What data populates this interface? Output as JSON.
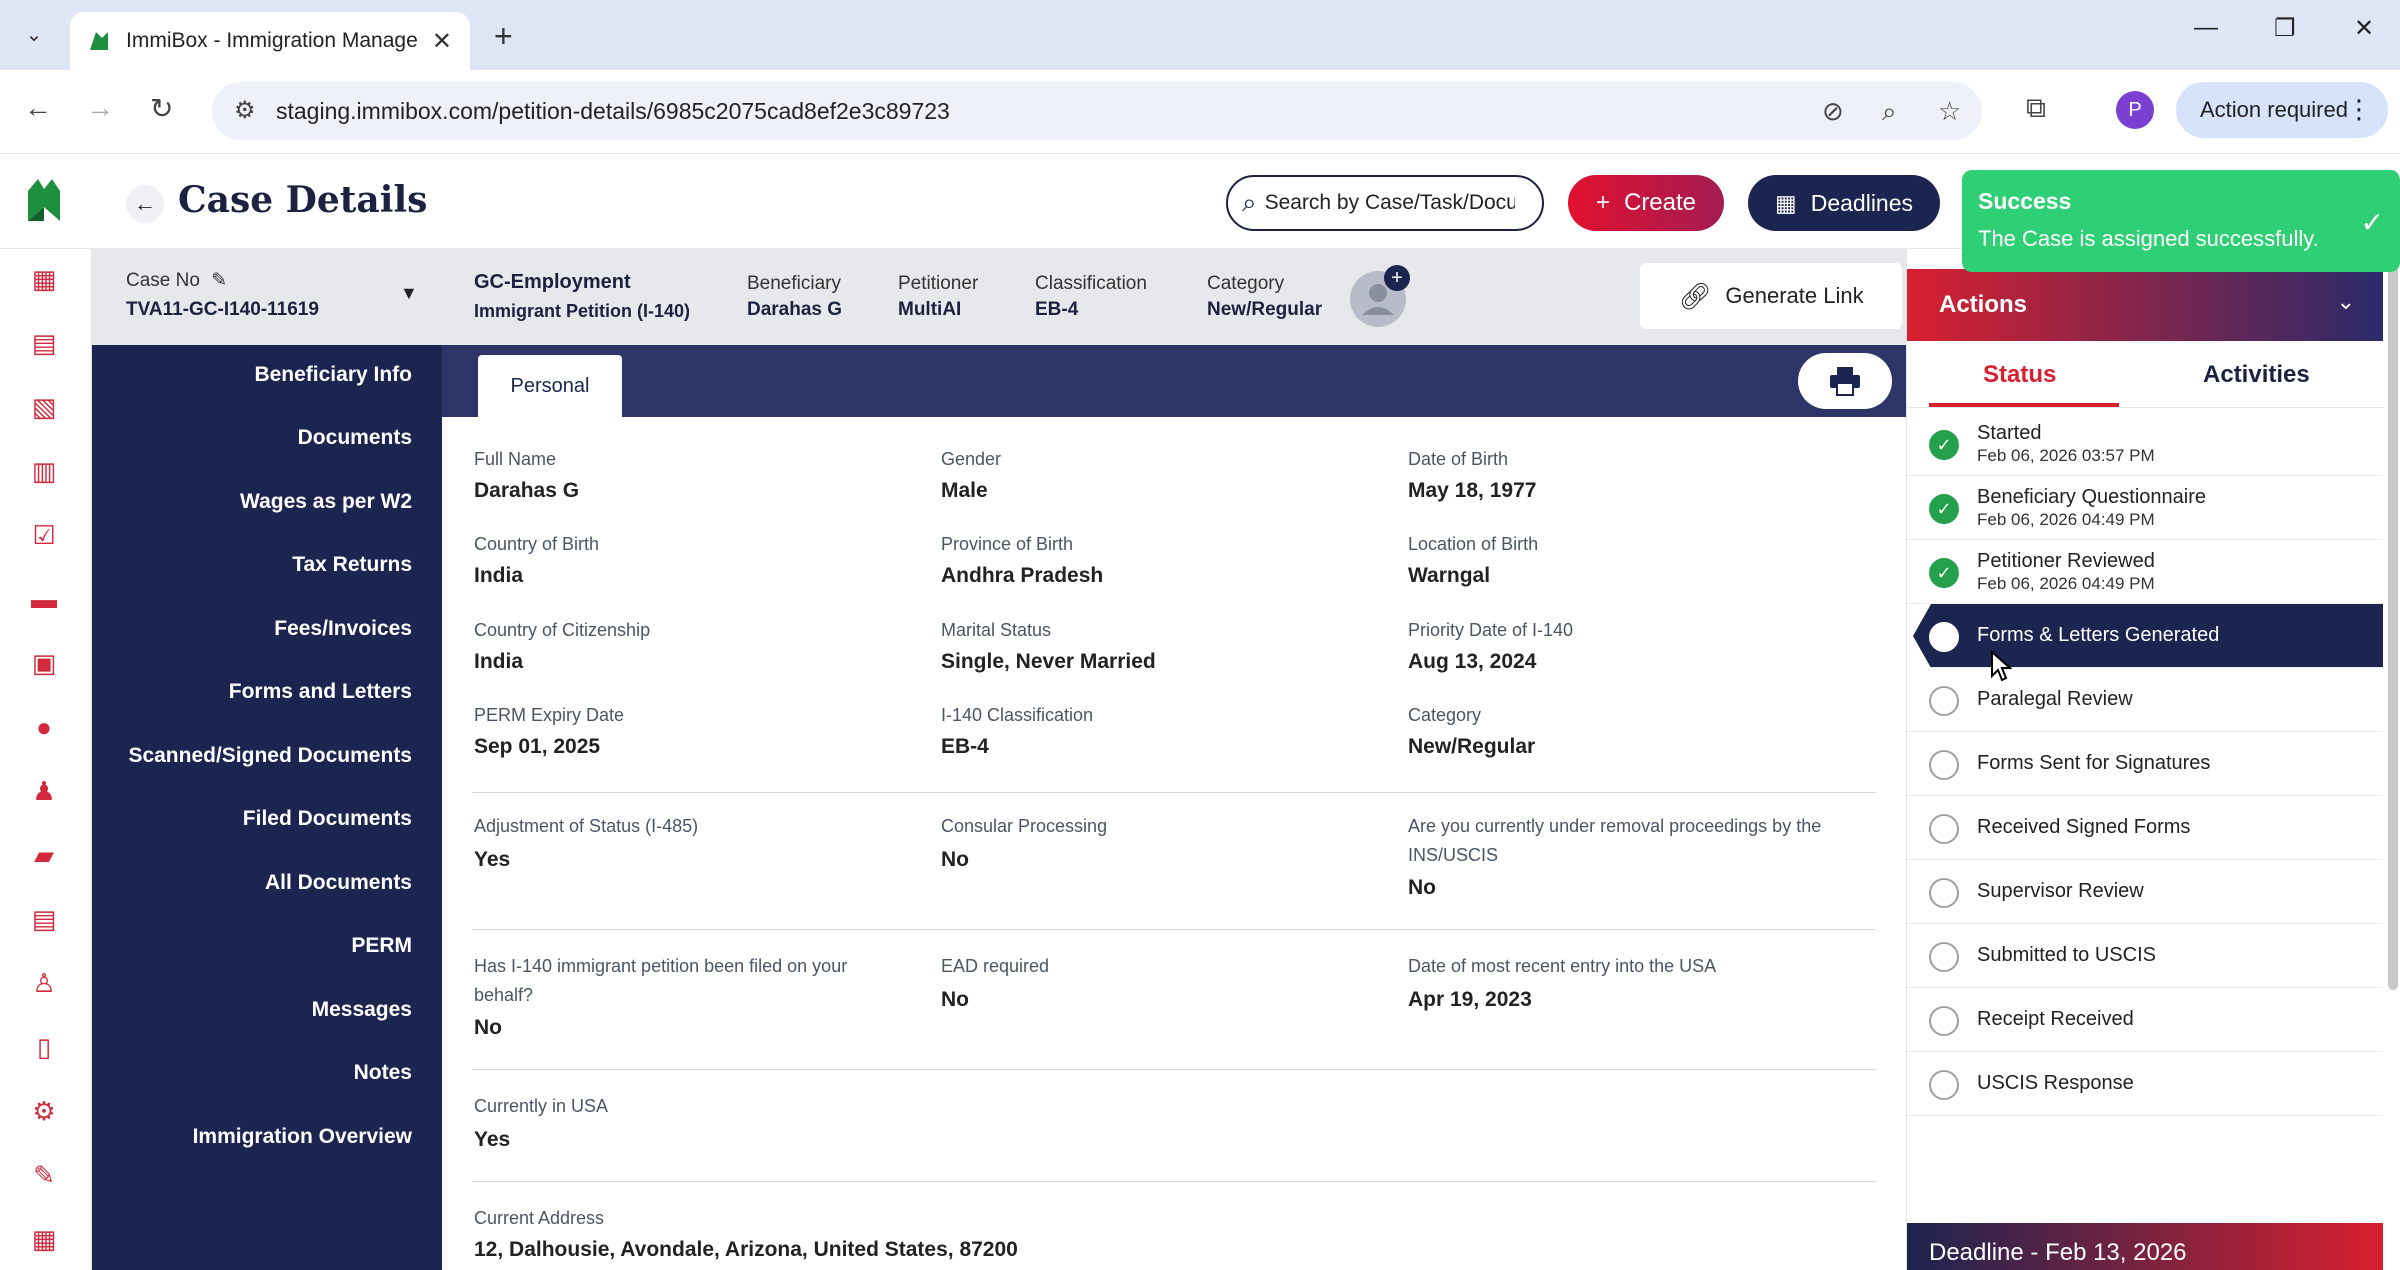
{
  "browser": {
    "tab_title": "ImmiBox - Immigration Manage",
    "url": "staging.immibox.com/petition-details/6985c2075cad8ef2e3c89723",
    "profile_initial": "P",
    "action_required": "Action required"
  },
  "header": {
    "title": "Case Details",
    "search_placeholder": "Search by Case/Task/Document",
    "create_label": "Create",
    "deadlines_label": "Deadlines"
  },
  "toast": {
    "title": "Success",
    "message": "The Case is assigned successfully."
  },
  "case_info": {
    "case_no_label": "Case No",
    "case_no": "TVA11-GC-I140-11619",
    "category_title": "GC-Employment",
    "petition_type": "Immigrant Petition (I-140)",
    "beneficiary_label": "Beneficiary",
    "beneficiary": "Darahas G",
    "petitioner_label": "Petitioner",
    "petitioner": "MultiAI",
    "classification_label": "Classification",
    "classification": "EB-4",
    "category_label": "Category",
    "category": "New/Regular",
    "generate_link": "Generate Link"
  },
  "section_nav": [
    "Beneficiary Info",
    "Documents",
    "Wages as per W2",
    "Tax Returns",
    "Fees/Invoices",
    "Forms and Letters",
    "Scanned/Signed Documents",
    "Filed Documents",
    "All Documents",
    "PERM",
    "Messages",
    "Notes",
    "Immigration Overview"
  ],
  "tab": {
    "personal": "Personal"
  },
  "fields": {
    "full_name": {
      "label": "Full Name",
      "value": "Darahas G"
    },
    "gender": {
      "label": "Gender",
      "value": "Male"
    },
    "dob": {
      "label": "Date of Birth",
      "value": "May 18, 1977"
    },
    "country_of_birth": {
      "label": "Country of Birth",
      "value": "India"
    },
    "province_of_birth": {
      "label": "Province of Birth",
      "value": "Andhra Pradesh"
    },
    "location_of_birth": {
      "label": "Location of Birth",
      "value": "Warngal"
    },
    "country_of_citizenship": {
      "label": "Country of Citizenship",
      "value": "India"
    },
    "marital_status": {
      "label": "Marital Status",
      "value": "Single, Never Married"
    },
    "priority_date": {
      "label": "Priority Date of I-140",
      "value": "Aug 13, 2024"
    },
    "perm_expiry": {
      "label": "PERM Expiry Date",
      "value": "Sep 01, 2025"
    },
    "i140_classification": {
      "label": "I-140 Classification",
      "value": "EB-4"
    },
    "category": {
      "label": "Category",
      "value": "New/Regular"
    },
    "adjustment_of_status": {
      "label": "Adjustment of Status (I-485)",
      "value": "Yes"
    },
    "consular_processing": {
      "label": "Consular Processing",
      "value": "No"
    },
    "removal_proceedings": {
      "label": "Are you currently under removal proceedings by the INS/USCIS",
      "value": "No"
    },
    "i140_filed": {
      "label": "Has I-140 immigrant petition been filed on your behalf?",
      "value": "No"
    },
    "ead_required": {
      "label": "EAD required",
      "value": "No"
    },
    "recent_entry": {
      "label": "Date of most recent entry into the USA",
      "value": "Apr 19, 2023"
    },
    "currently_in_usa": {
      "label": "Currently in USA",
      "value": "Yes"
    },
    "current_address": {
      "label": "Current Address",
      "value": "12, Dalhousie, Avondale, Arizona, United States, 87200"
    }
  },
  "actions": {
    "title": "Actions",
    "tab_status": "Status",
    "tab_activities": "Activities",
    "statuses": [
      {
        "label": "Started",
        "date": "Feb 06, 2026 03:57 PM"
      },
      {
        "label": "Beneficiary Questionnaire",
        "date": "Feb 06, 2026 04:49 PM"
      },
      {
        "label": "Petitioner Reviewed",
        "date": "Feb 06, 2026 04:49 PM"
      },
      {
        "label": "Forms & Letters Generated"
      },
      {
        "label": "Paralegal Review"
      },
      {
        "label": "Forms Sent for Signatures"
      },
      {
        "label": "Received Signed Forms"
      },
      {
        "label": "Supervisor Review"
      },
      {
        "label": "Submitted to USCIS"
      },
      {
        "label": "Receipt Received"
      },
      {
        "label": "USCIS Response"
      }
    ],
    "deadline": "Deadline - Feb 13, 2026"
  },
  "colors": {
    "navy": "#1c2450",
    "brand_red": "#d8202f",
    "success_green": "#2fcf76",
    "done_green": "#22a04b"
  }
}
